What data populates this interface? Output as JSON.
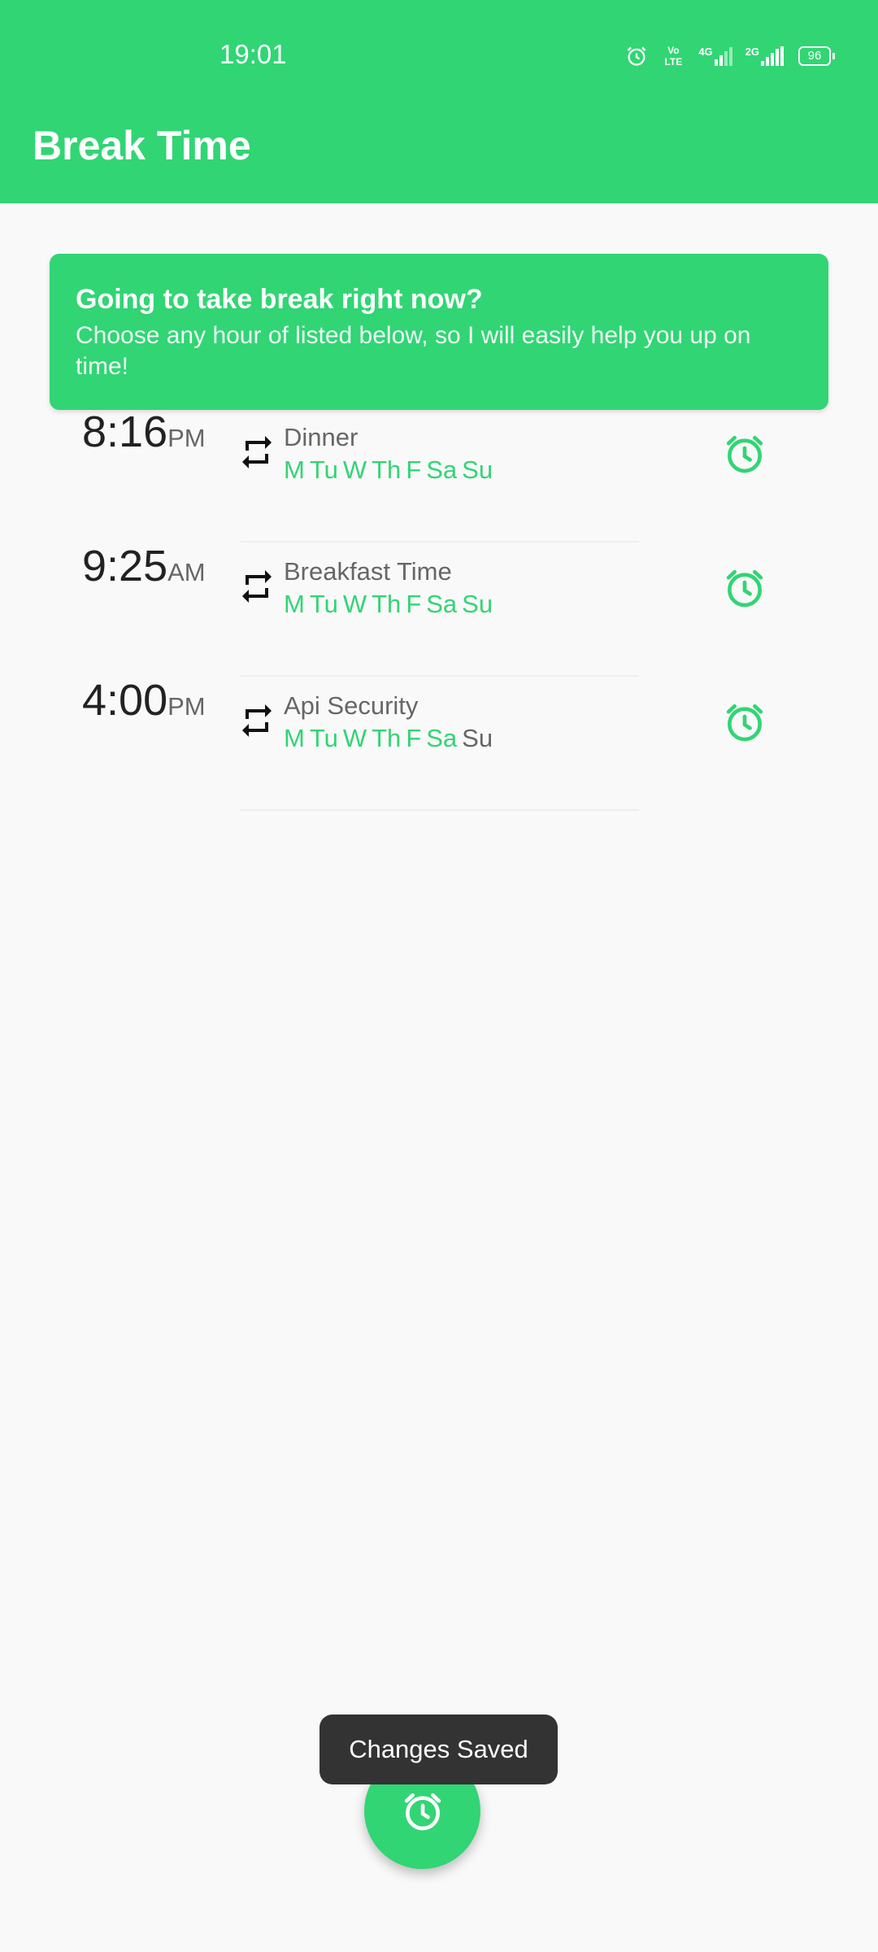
{
  "status_bar": {
    "time": "19:01",
    "battery": "96",
    "net_volte": "Vo LTE",
    "net_4g": "4G",
    "net_2g": "2G"
  },
  "app": {
    "title": "Break Time",
    "accent": "#31d574"
  },
  "banner": {
    "title": "Going to take break right now?",
    "subtitle": "Choose any hour of listed below, so I will easily help you up on time!"
  },
  "alarms": [
    {
      "time": "8:16",
      "ampm": "PM",
      "label": "Dinner",
      "days": [
        {
          "d": "M",
          "on": true
        },
        {
          "d": "Tu",
          "on": true
        },
        {
          "d": "W",
          "on": true
        },
        {
          "d": "Th",
          "on": true
        },
        {
          "d": "F",
          "on": true
        },
        {
          "d": "Sa",
          "on": true
        },
        {
          "d": "Su",
          "on": true
        }
      ]
    },
    {
      "time": "9:25",
      "ampm": "AM",
      "label": "Breakfast Time",
      "days": [
        {
          "d": "M",
          "on": true
        },
        {
          "d": "Tu",
          "on": true
        },
        {
          "d": "W",
          "on": true
        },
        {
          "d": "Th",
          "on": true
        },
        {
          "d": "F",
          "on": true
        },
        {
          "d": "Sa",
          "on": true
        },
        {
          "d": "Su",
          "on": true
        }
      ]
    },
    {
      "time": "4:00",
      "ampm": "PM",
      "label": "Api Security",
      "days": [
        {
          "d": "M",
          "on": true
        },
        {
          "d": "Tu",
          "on": true
        },
        {
          "d": "W",
          "on": true
        },
        {
          "d": "Th",
          "on": true
        },
        {
          "d": "F",
          "on": true
        },
        {
          "d": "Sa",
          "on": true
        },
        {
          "d": "Su",
          "on": false
        }
      ]
    }
  ],
  "toast": {
    "text": "Changes Saved"
  },
  "fab": {
    "icon": "alarm-add-icon"
  }
}
